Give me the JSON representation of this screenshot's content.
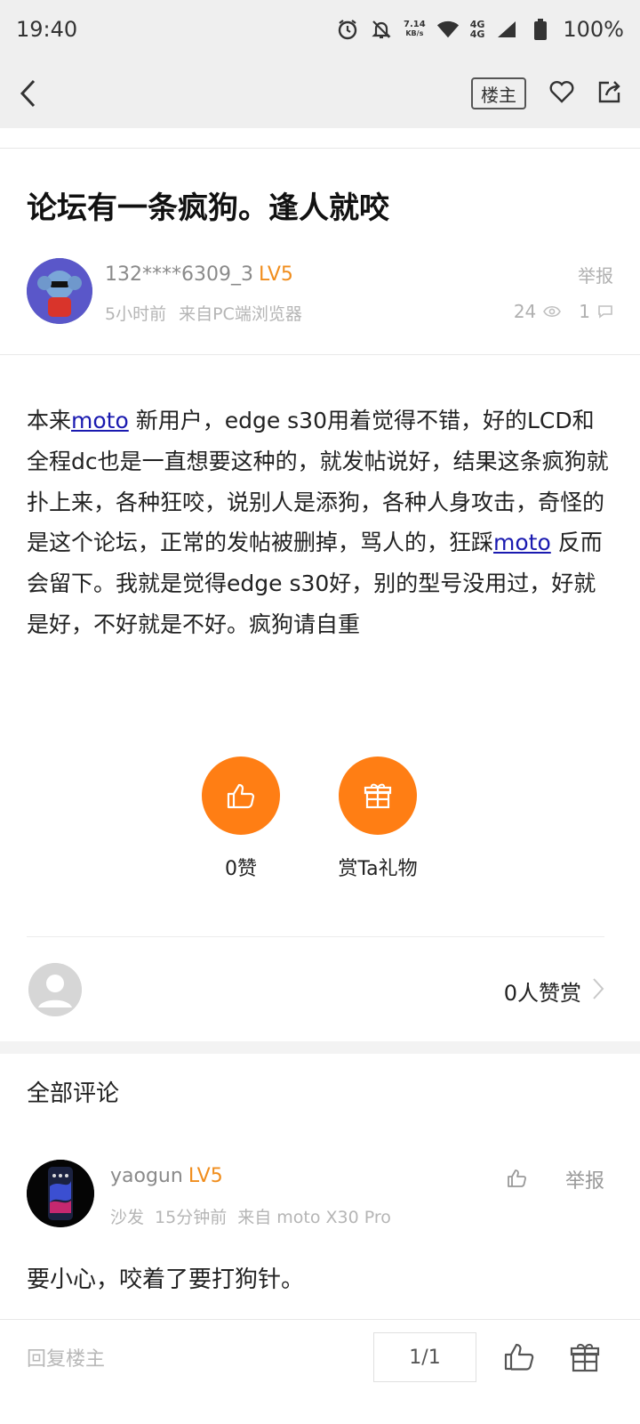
{
  "status_bar": {
    "time": "19:40",
    "net_speed_value": "7.14",
    "net_speed_unit": "KB/s",
    "net_type_1": "4G",
    "net_type_2": "4G",
    "battery": "100%",
    "icons": [
      "alarm-icon",
      "bell-off-icon",
      "wifi-icon",
      "signal-icon",
      "battery-icon"
    ]
  },
  "top_bar": {
    "owner_label": "楼主",
    "icons": [
      "back-arrow-icon",
      "heart-icon",
      "share-icon"
    ]
  },
  "post": {
    "title": "论坛有一条疯狗。逢人就咬",
    "author": {
      "name": "132****6309_3",
      "level": "LV5",
      "time": "5小时前",
      "source": "来自PC端浏览器"
    },
    "report_label": "举报",
    "views": "24",
    "comments_count": "1",
    "body": {
      "p1": "本来",
      "link1": "moto",
      "p2": " 新用户，edge s30用着觉得不错，好的LCD和全程dc也是一直想要这种的，就发帖说好，结果这条疯狗就扑上来，各种狂咬，说别人是添狗，各种人身攻击，奇怪的是这个论坛，正常的发帖被删掉，骂人的，狂踩",
      "link2": "moto",
      "p3": " 反而会留下。我就是觉得edge s30好，别的型号没用过，好就是好，不好就是不好。疯狗请自重"
    }
  },
  "reactions": {
    "like_label": "0赞",
    "gift_label": "赏Ta礼物"
  },
  "reward": {
    "count_label": "0人赞赏"
  },
  "comments": {
    "section_title": "全部评论",
    "items": [
      {
        "name": "yaogun",
        "level": "LV5",
        "floor": "沙发",
        "time": "15分钟前",
        "source": "来自 moto X30 Pro",
        "report_label": "举报",
        "text": "要小心，咬着了要打狗针。"
      }
    ]
  },
  "bottom_bar": {
    "reply_placeholder": "回复楼主",
    "page_indicator": "1/1"
  },
  "colors": {
    "accent": "#ff7e14",
    "level": "#f08d1d",
    "link": "#1a1ab0",
    "header_bg": "#efefef"
  }
}
